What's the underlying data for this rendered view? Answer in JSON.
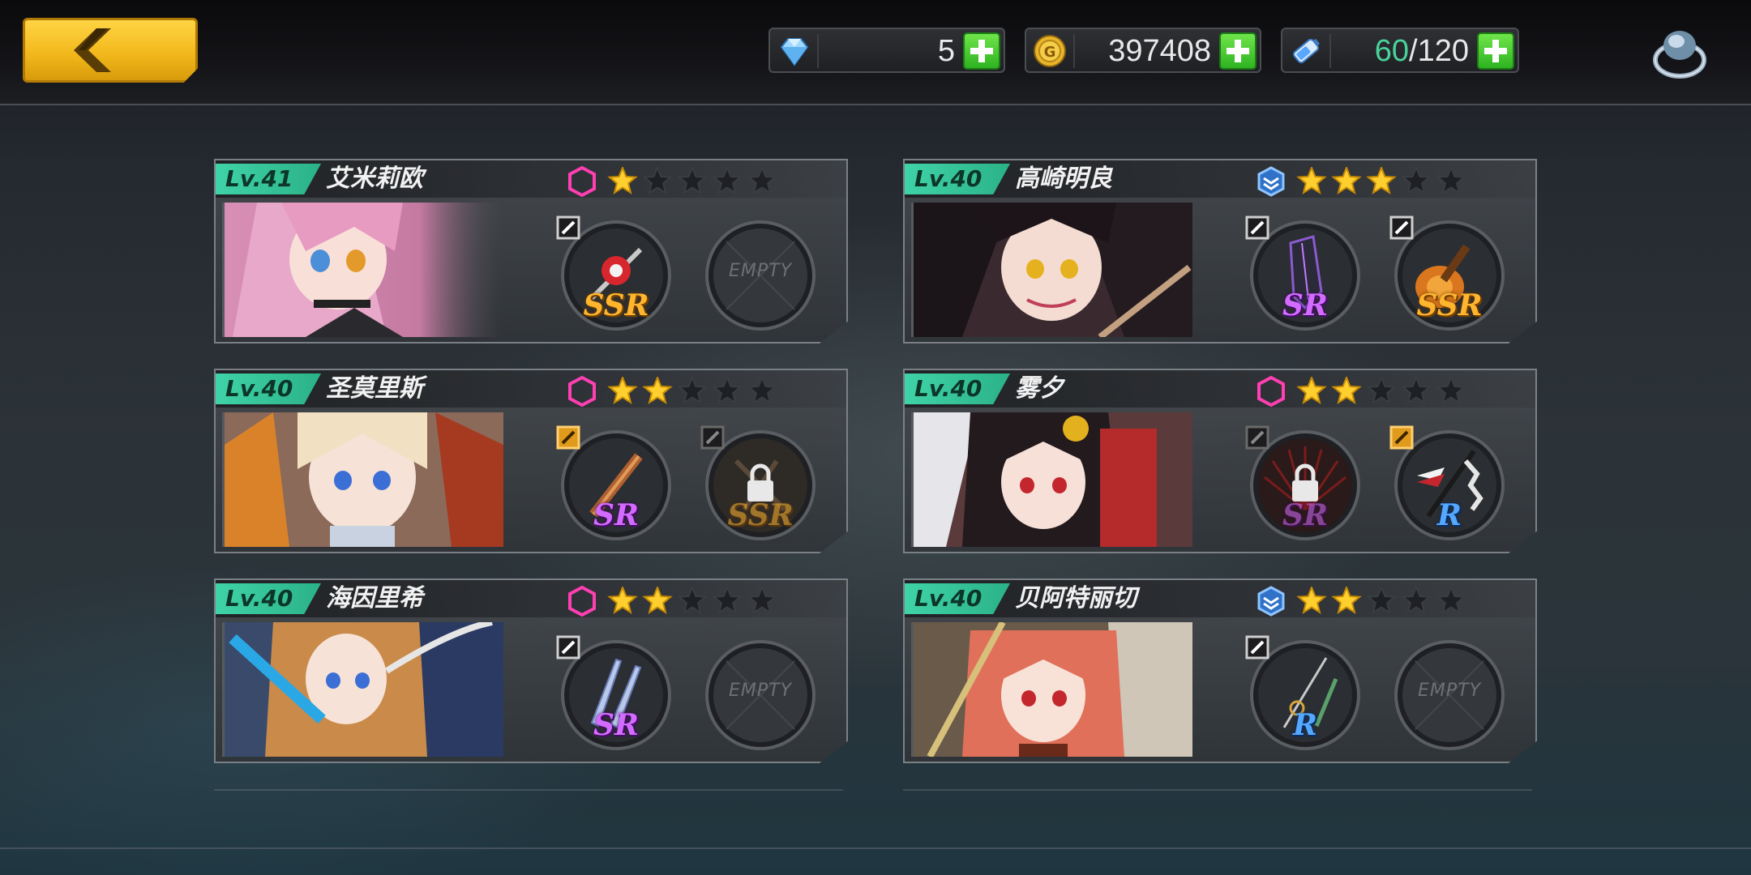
{
  "resources": {
    "gems": {
      "value": "5",
      "icon": "diamond-icon"
    },
    "gold": {
      "value": "397408",
      "icon": "gold-coin-icon"
    },
    "stamina": {
      "current": "60",
      "max": "/120",
      "icon": "energy-battery-icon"
    }
  },
  "characters": [
    {
      "level": "Lv.41",
      "name": "艾米莉欧",
      "stars": 1,
      "class_icon": "pink-hexagon-icon",
      "slots": [
        {
          "type": "weapon",
          "rarity": "SSR",
          "tag_color": "gray"
        },
        {
          "type": "empty",
          "label": "EMPTY"
        }
      ]
    },
    {
      "level": "Lv.40",
      "name": "高崎明良",
      "stars": 3,
      "class_icon": "blue-layers-icon",
      "slots": [
        {
          "type": "weapon",
          "rarity": "SR",
          "tag_color": "gray"
        },
        {
          "type": "weapon",
          "rarity": "SSR",
          "tag_color": "gray"
        }
      ]
    },
    {
      "level": "Lv.40",
      "name": "圣莫里斯",
      "stars": 2,
      "class_icon": "pink-hexagon-icon",
      "slots": [
        {
          "type": "weapon",
          "rarity": "SR",
          "tag_color": "orange"
        },
        {
          "type": "locked",
          "rarity": "SSR",
          "tag_color": "dark"
        }
      ]
    },
    {
      "level": "Lv.40",
      "name": "雾夕",
      "stars": 2,
      "class_icon": "pink-hexagon-icon",
      "slots": [
        {
          "type": "locked",
          "rarity": "SR",
          "tag_color": "dark"
        },
        {
          "type": "weapon",
          "rarity": "R",
          "tag_color": "orange"
        }
      ]
    },
    {
      "level": "Lv.40",
      "name": "海因里希",
      "stars": 2,
      "class_icon": "pink-hexagon-icon",
      "slots": [
        {
          "type": "weapon",
          "rarity": "SR",
          "tag_color": "gray"
        },
        {
          "type": "empty",
          "label": "EMPTY"
        }
      ]
    },
    {
      "level": "Lv.40",
      "name": "贝阿特丽切",
      "stars": 2,
      "class_icon": "blue-layers-icon",
      "slots": [
        {
          "type": "weapon",
          "rarity": "R",
          "tag_color": "gray"
        },
        {
          "type": "empty",
          "label": "EMPTY"
        }
      ]
    }
  ],
  "colors": {
    "accent_green": "#3fd3a7",
    "star_gold": "#ffcf2e",
    "back_yellow": "#f2b91c"
  }
}
